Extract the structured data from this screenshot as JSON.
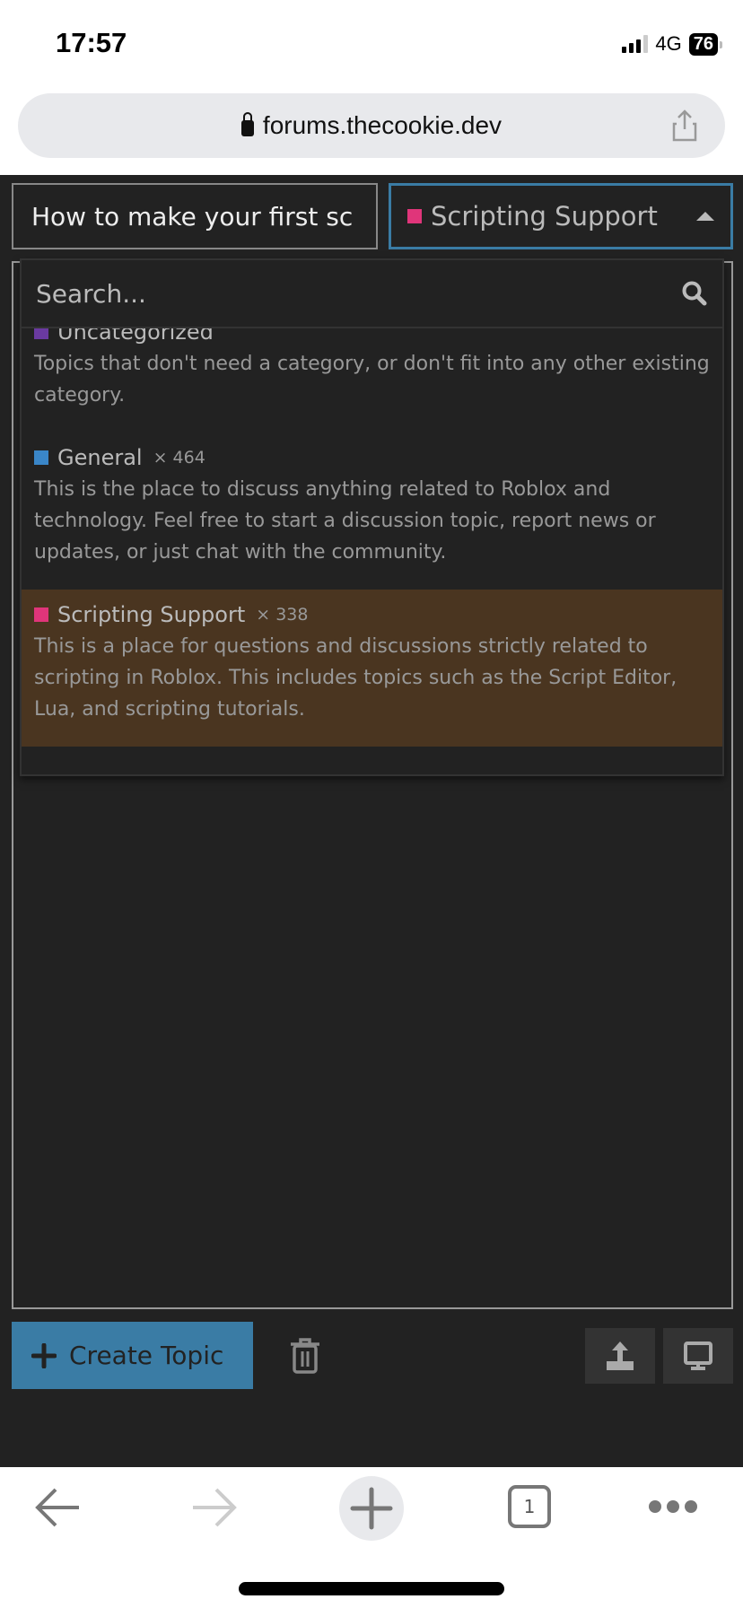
{
  "status": {
    "time": "17:57",
    "network": "4G",
    "battery": "76"
  },
  "browser": {
    "url": "forums.thecookie.dev",
    "tab_count": "1"
  },
  "composer": {
    "title_value": "How to make your first sc",
    "category_selected": "Scripting Support",
    "category_color": "#e0357a",
    "search_placeholder": "Search...",
    "categories": [
      {
        "name": "Uncategorized",
        "count": "",
        "color": "#6a3aa0",
        "description": "Topics that don't need a category, or don't fit into any other existing category."
      },
      {
        "name": "General",
        "count": "× 464",
        "color": "#3a86c8",
        "description": "This is the place to discuss anything related to Roblox and technology. Feel free to start a discussion topic, report news or updates, or just chat with the community."
      },
      {
        "name": "Scripting Support",
        "count": "× 338",
        "color": "#e0357a",
        "description": "This is a place for questions and discussions strictly related to scripting in Roblox. This includes topics such as the Script Editor, Lua, and scripting tutorials.",
        "highlighted": true
      }
    ],
    "create_label": "Create Topic",
    "accent": "#3a7ca5"
  }
}
